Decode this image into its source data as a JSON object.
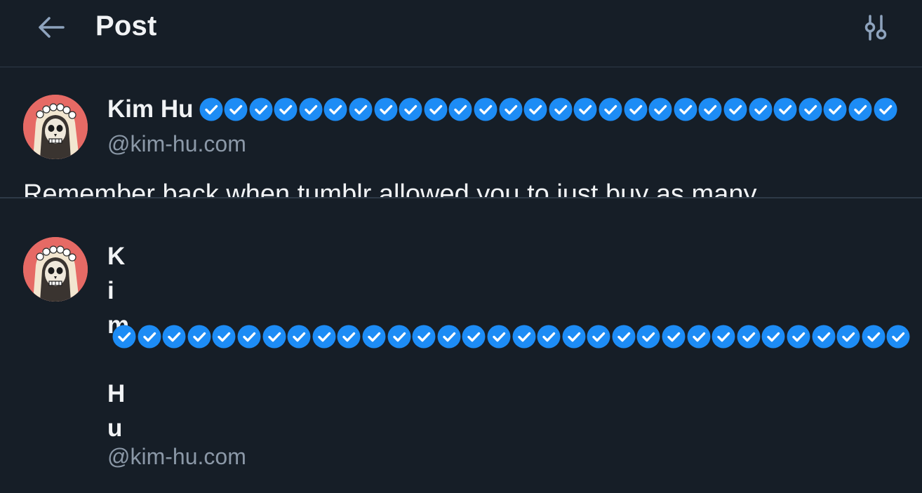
{
  "header": {
    "title": "Post",
    "back_icon": "arrow-left-icon",
    "settings_icon": "sliders-icon"
  },
  "post": {
    "display_name": "Kim Hu",
    "handle": "@kim-hu.com",
    "badge_icon": "verified-check-icon",
    "badge_count": 28,
    "text": "Remember back when tumblr allowed you to just buy as many"
  },
  "post_squished": {
    "name_letters": [
      "K",
      "i",
      "m",
      "",
      "H",
      "u"
    ],
    "handle": "@kim-hu.com",
    "badge_count": 32
  },
  "colors": {
    "background": "#161e27",
    "divider": "#2e3a47",
    "badge_blue": "#1d8cf5",
    "muted_text": "#8b98a7",
    "avatar_bg": "#e66a65"
  }
}
